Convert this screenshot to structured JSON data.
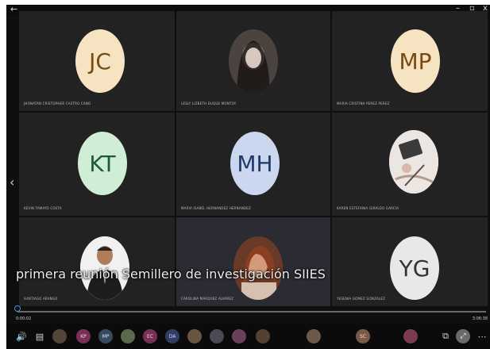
{
  "window": {
    "back_icon": "back-arrow-icon",
    "minimize": "–",
    "restore": "▫",
    "close": "x"
  },
  "participants": [
    {
      "initials": "JC",
      "name": "JHONATAN CRISTOPHER CASTRO CANO",
      "style": "cream"
    },
    {
      "initials": "",
      "name": "LESLY LIZBETH DUQUE MONTOY",
      "style": "photo"
    },
    {
      "initials": "MP",
      "name": "MARIA CRISTINA PEREZ PEREZ",
      "style": "cream"
    },
    {
      "initials": "KT",
      "name": "KEVIN TAMAYO COSTA",
      "style": "mint"
    },
    {
      "initials": "MH",
      "name": "MARIA ISABEL HERNANDEZ HERNANDEZ",
      "style": "blue"
    },
    {
      "initials": "",
      "name": "KAREN ESTEFANIA GIRALDO GARCIA",
      "style": "photo"
    },
    {
      "initials": "",
      "name": "SANTIAGO ARANGO",
      "style": "photo"
    },
    {
      "initials": "",
      "name": "CAROLINA MARQUEZ ALVAREZ",
      "style": "photo"
    },
    {
      "initials": "YG",
      "name": "YESENIA GOMEZ GONZALEZ",
      "style": "gray"
    }
  ],
  "caption": "primera reunión Semillero de investigación SIIES",
  "playback": {
    "elapsed": "0:00:02",
    "total": "3:06:38",
    "progress_fraction": 0.0
  },
  "toolbar_initials": [
    "KP",
    "MP",
    "EC",
    "DA",
    "SC"
  ]
}
